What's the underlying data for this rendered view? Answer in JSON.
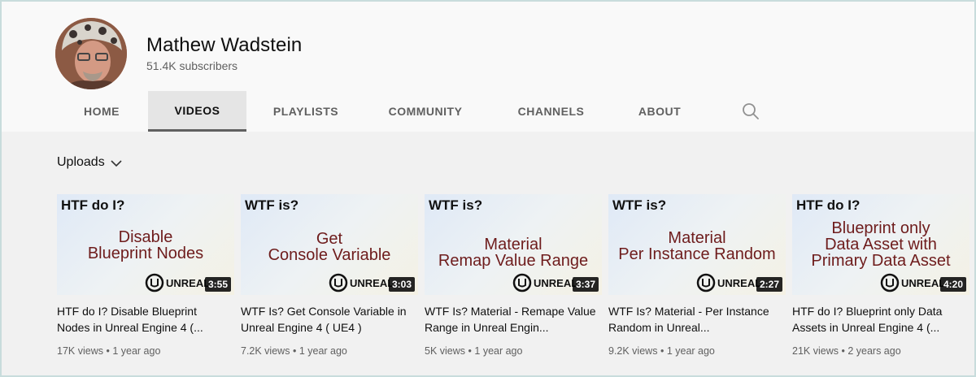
{
  "channel": {
    "name": "Mathew Wadstein",
    "subscribers": "51.4K subscribers"
  },
  "tabs": [
    {
      "label": "HOME",
      "active": false
    },
    {
      "label": "VIDEOS",
      "active": true
    },
    {
      "label": "PLAYLISTS",
      "active": false
    },
    {
      "label": "COMMUNITY",
      "active": false
    },
    {
      "label": "CHANNELS",
      "active": false
    },
    {
      "label": "ABOUT",
      "active": false
    }
  ],
  "icons": {
    "search": "search-icon",
    "dropdown": "chevron-down-icon"
  },
  "uploads_label": "Uploads",
  "videos": [
    {
      "kicker": "HTF do I?",
      "topic_lines": [
        "Disable",
        "Blueprint Nodes"
      ],
      "duration": "3:55",
      "title": "HTF do I? Disable Blueprint Nodes in Unreal Engine 4 (...",
      "views": "17K views",
      "age": "1 year ago"
    },
    {
      "kicker": "WTF is?",
      "topic_lines": [
        "Get",
        "Console Variable"
      ],
      "duration": "3:03",
      "title": "WTF Is? Get Console Variable in Unreal Engine 4 ( UE4 )",
      "views": "7.2K views",
      "age": "1 year ago"
    },
    {
      "kicker": "WTF is?",
      "topic_lines": [
        "Material",
        "Remap Value Range"
      ],
      "duration": "3:37",
      "title": "WTF Is? Material - Remape Value Range in Unreal Engin...",
      "views": "5K views",
      "age": "1 year ago"
    },
    {
      "kicker": "WTF is?",
      "topic_lines": [
        "Material",
        "Per Instance Random"
      ],
      "duration": "2:27",
      "title": "WTF Is? Material - Per Instance Random in Unreal...",
      "views": "9.2K views",
      "age": "1 year ago"
    },
    {
      "kicker": "HTF do I?",
      "topic_lines": [
        "Blueprint only",
        "Data Asset with",
        "Primary Data Asset"
      ],
      "duration": "4:20",
      "title": "HTF do I? Blueprint only Data Assets in Unreal Engine 4 (...",
      "views": "21K views",
      "age": "2 years ago"
    }
  ],
  "meta_separator": "•",
  "thumbnail_logo_text": "UNREAL",
  "colors": {
    "header_bg": "#f9f9f9",
    "page_bg": "#f1f1f1",
    "topic_text": "#6e1c1c",
    "secondary_text": "#606060"
  }
}
